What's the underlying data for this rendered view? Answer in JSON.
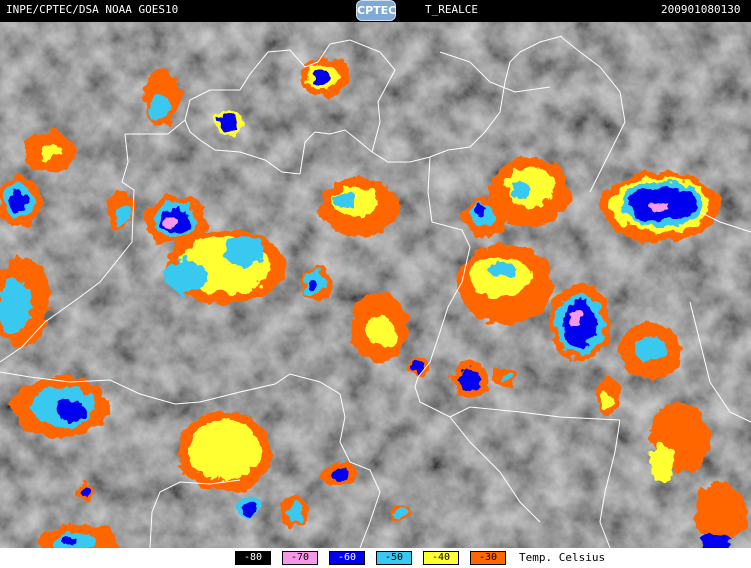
{
  "header": {
    "left_text": "INPE/CPTEC/DSA  NOAA  GOES10",
    "logo_text": "CPTEC",
    "product": "T_REALCE",
    "timestamp": "200901080130"
  },
  "legend": {
    "items": [
      {
        "label": "-80",
        "color": "#000000",
        "text_color": "#ffffff"
      },
      {
        "label": "-70",
        "color": "#f598e8",
        "text_color": "#000000"
      },
      {
        "label": "-60",
        "color": "#0000ee",
        "text_color": "#ffffff"
      },
      {
        "label": "-50",
        "color": "#38c8f0",
        "text_color": "#000000"
      },
      {
        "label": "-40",
        "color": "#ffff33",
        "text_color": "#000000"
      },
      {
        "label": "-30",
        "color": "#ff6600",
        "text_color": "#000000"
      }
    ],
    "unit": "Temp. Celsius"
  },
  "map": {
    "background_gray": "#5a5a5a",
    "border_color": "#ffffff"
  }
}
